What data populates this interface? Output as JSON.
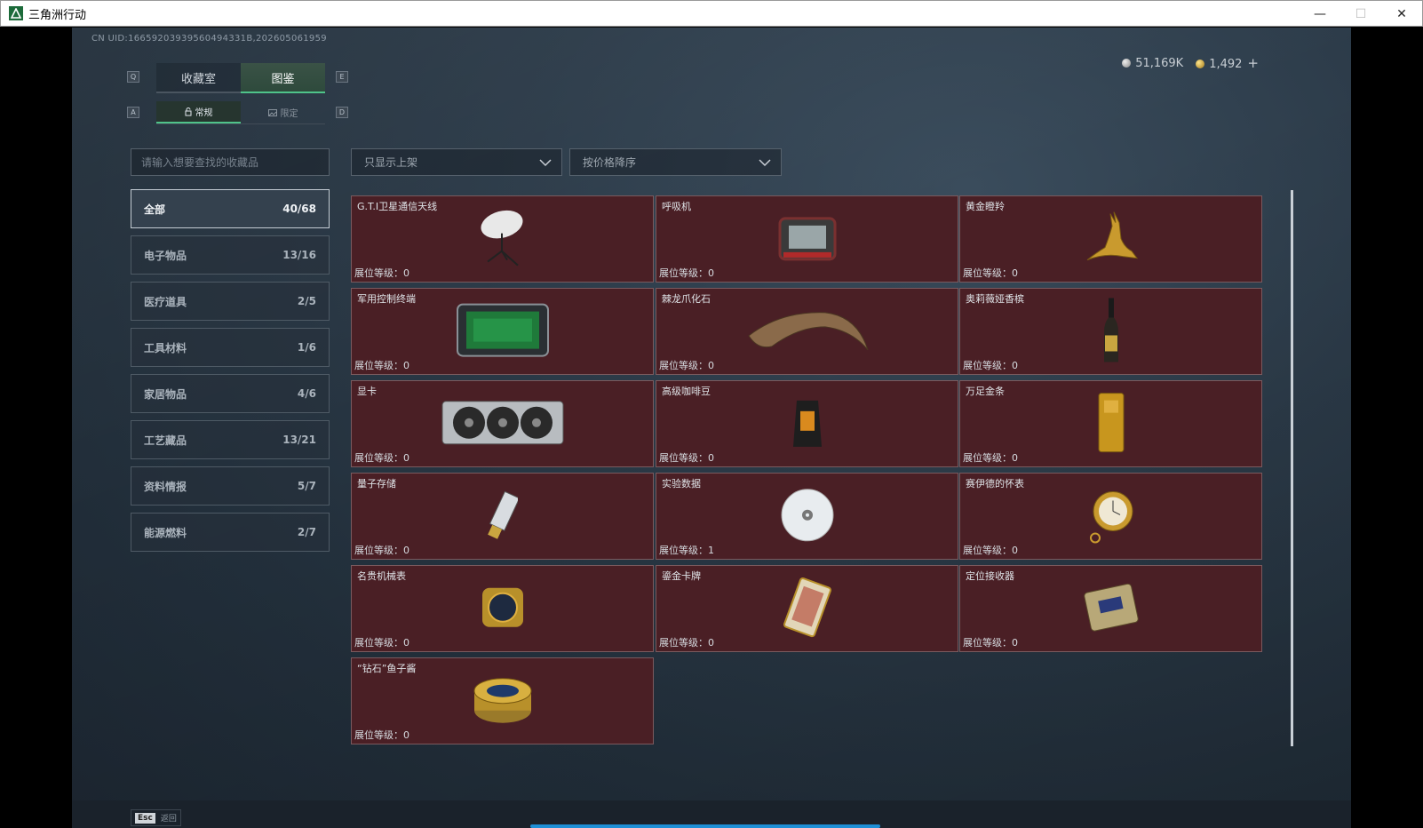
{
  "window": {
    "title": "三角洲行动",
    "minimize": "—",
    "maximize": "☐",
    "close": "✕"
  },
  "header": {
    "uid": "CN UID:16659203939560494331B,202605061959",
    "currency_silver": "51,169K",
    "currency_gold": "1,492",
    "plus": "+"
  },
  "keys": {
    "tab_left": "Q",
    "tab_right": "E",
    "sub_left": "A",
    "sub_right": "D"
  },
  "tabs": [
    {
      "label": "收藏室"
    },
    {
      "label": "图鉴"
    }
  ],
  "subtabs": [
    {
      "label": "常规"
    },
    {
      "label": "限定"
    }
  ],
  "search": {
    "placeholder": "请输入想要查找的收藏品"
  },
  "filters": {
    "shelf": "只显示上架",
    "sort": "按价格降序"
  },
  "categories": [
    {
      "label": "全部",
      "count": "40/68"
    },
    {
      "label": "电子物品",
      "count": "13/16"
    },
    {
      "label": "医疗道具",
      "count": "2/5"
    },
    {
      "label": "工具材料",
      "count": "1/6"
    },
    {
      "label": "家居物品",
      "count": "4/6"
    },
    {
      "label": "工艺藏品",
      "count": "13/21"
    },
    {
      "label": "资料情报",
      "count": "5/7"
    },
    {
      "label": "能源燃料",
      "count": "2/7"
    }
  ],
  "items": [
    {
      "name": "G.T.I卫星通信天线",
      "level": "展位等级：0",
      "icon": "satellite-dish-icon"
    },
    {
      "name": "呼吸机",
      "level": "展位等级：0",
      "icon": "ventilator-icon"
    },
    {
      "name": "黄金瞪羚",
      "level": "展位等级：0",
      "icon": "golden-gazelle-icon"
    },
    {
      "name": "军用控制终端",
      "level": "展位等级：0",
      "icon": "control-terminal-icon"
    },
    {
      "name": "棘龙爪化石",
      "level": "展位等级：0",
      "icon": "claw-fossil-icon"
    },
    {
      "name": "奥莉薇娅香槟",
      "level": "展位等级：0",
      "icon": "champagne-icon"
    },
    {
      "name": "显卡",
      "level": "展位等级：0",
      "icon": "graphics-card-icon"
    },
    {
      "name": "高级咖啡豆",
      "level": "展位等级：0",
      "icon": "coffee-bag-icon"
    },
    {
      "name": "万足金条",
      "level": "展位等级：0",
      "icon": "gold-bar-icon"
    },
    {
      "name": "量子存储",
      "level": "展位等级：0",
      "icon": "usb-drive-icon"
    },
    {
      "name": "实验数据",
      "level": "展位等级：1",
      "icon": "disc-icon"
    },
    {
      "name": "赛伊德的怀表",
      "level": "展位等级：0",
      "icon": "pocket-watch-icon"
    },
    {
      "name": "名贵机械表",
      "level": "展位等级：0",
      "icon": "wristwatch-icon"
    },
    {
      "name": "鎏金卡牌",
      "level": "展位等级：0",
      "icon": "gilded-card-icon"
    },
    {
      "name": "定位接收器",
      "level": "展位等级：0",
      "icon": "locator-receiver-icon"
    },
    {
      "name": "“钻石”鱼子酱",
      "level": "展位等级：0",
      "icon": "caviar-tin-icon"
    }
  ],
  "footer": {
    "esc_key": "Esc",
    "back": "返回"
  },
  "colors": {
    "accent": "#4fc38a",
    "card_bg": "#4a1f25",
    "progress": "#1e8fd6"
  }
}
